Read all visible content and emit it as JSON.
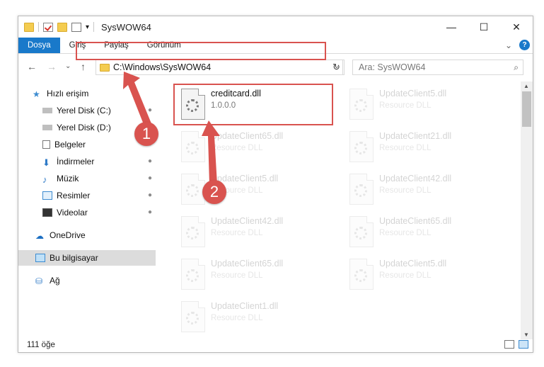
{
  "window": {
    "title": "SysWOW64",
    "controls": {
      "minimize": "—",
      "maximize": "☐",
      "close": "✕"
    }
  },
  "ribbon": {
    "tabs": [
      "Dosya",
      "Giriş",
      "Paylaş",
      "Görünüm"
    ],
    "expand": "⌄",
    "help": "?"
  },
  "navigation": {
    "back": "←",
    "forward": "→",
    "recent": "⌄",
    "up": "↑",
    "address": "C:\\Windows\\SysWOW64",
    "address_dropdown": "⌄",
    "refresh": "↻",
    "search_placeholder": "Ara: SysWOW64",
    "search_icon": "⌕"
  },
  "sidebar": {
    "items": [
      {
        "label": "Hızlı erişim",
        "icon": "star-icon",
        "pinned": false
      },
      {
        "label": "Yerel Disk (C:)",
        "icon": "drive-icon",
        "pinned": true
      },
      {
        "label": "Yerel Disk (D:)",
        "icon": "drive-icon",
        "pinned": false
      },
      {
        "label": "Belgeler",
        "icon": "documents-icon",
        "pinned": true
      },
      {
        "label": "İndirmeler",
        "icon": "download-icon",
        "pinned": true
      },
      {
        "label": "Müzik",
        "icon": "music-icon",
        "pinned": true
      },
      {
        "label": "Resimler",
        "icon": "pictures-icon",
        "pinned": true
      },
      {
        "label": "Videolar",
        "icon": "videos-icon",
        "pinned": true
      },
      {
        "label": "OneDrive",
        "icon": "cloud-icon",
        "pinned": false
      },
      {
        "label": "Bu bilgisayar",
        "icon": "computer-icon",
        "pinned": false,
        "selected": true
      },
      {
        "label": "Ağ",
        "icon": "network-icon",
        "pinned": false
      }
    ],
    "pin_glyph": "📌"
  },
  "files": {
    "highlighted": {
      "name": "creditcard.dll",
      "sub": "1.0.0.0"
    },
    "faded": [
      {
        "name": "UpdateClient5.dll",
        "sub": "Resource DLL"
      },
      {
        "name": "UpdateClient65.dll",
        "sub": "Resource DLL"
      },
      {
        "name": "UpdateClient21.dll",
        "sub": "Resource DLL"
      },
      {
        "name": "UpdateClient5.dll",
        "sub": "Resource DLL"
      },
      {
        "name": "UpdateClient42.dll",
        "sub": "Resource DLL"
      },
      {
        "name": "UpdateClient42.dll",
        "sub": "Resource DLL"
      },
      {
        "name": "UpdateClient65.dll",
        "sub": "Resource DLL"
      },
      {
        "name": "UpdateClient65.dll",
        "sub": "Resource DLL"
      },
      {
        "name": "UpdateClient5.dll",
        "sub": "Resource DLL"
      },
      {
        "name": "UpdateClient1.dll",
        "sub": "Resource DLL"
      }
    ]
  },
  "status": {
    "count": "111 öğe"
  },
  "annotations": {
    "badge1": "1",
    "badge2": "2",
    "color": "#d9534f"
  },
  "colors": {
    "accent": "#1979ca",
    "highlight": "#d9534f"
  }
}
